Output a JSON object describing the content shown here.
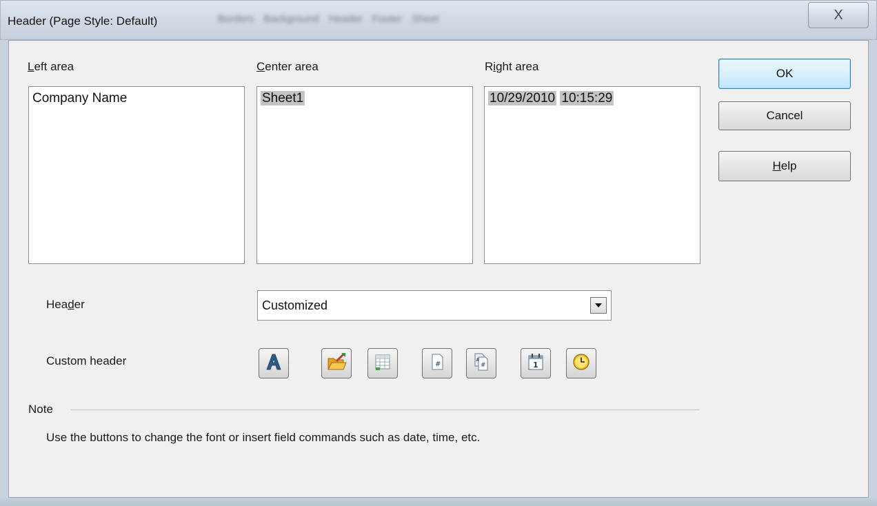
{
  "window": {
    "title": "Header (Page Style: Default)",
    "background_tabs": [
      "Borders",
      "Background",
      "Header",
      "Footer",
      "Sheet"
    ],
    "close_label": "X"
  },
  "areas": {
    "left": {
      "label_accel": "L",
      "label_rest": "eft area",
      "content": "Company Name"
    },
    "center": {
      "label_accel": "C",
      "label_rest": "enter area",
      "field": "Sheet1"
    },
    "right": {
      "label_pre": "R",
      "label_accel": "i",
      "label_rest": "ght area",
      "date_field": "10/29/2010",
      "time_field": "10:15:29"
    }
  },
  "buttons": {
    "ok": "OK",
    "cancel": "Cancel",
    "help_accel": "H",
    "help_rest": "elp"
  },
  "header_row": {
    "label_pre": "Hea",
    "label_accel": "d",
    "label_rest": "er",
    "selected": "Customized"
  },
  "custom_header": {
    "label": "Custom header",
    "tools": [
      {
        "icon": "text-attributes-icon"
      },
      {
        "icon": "title-icon"
      },
      {
        "icon": "sheet-name-icon"
      },
      {
        "icon": "page-number-icon"
      },
      {
        "icon": "page-count-icon"
      },
      {
        "icon": "date-icon"
      },
      {
        "icon": "time-icon"
      }
    ]
  },
  "note": {
    "label": "Note",
    "text": "Use the buttons to change the font or insert field commands such as date, time, etc."
  }
}
